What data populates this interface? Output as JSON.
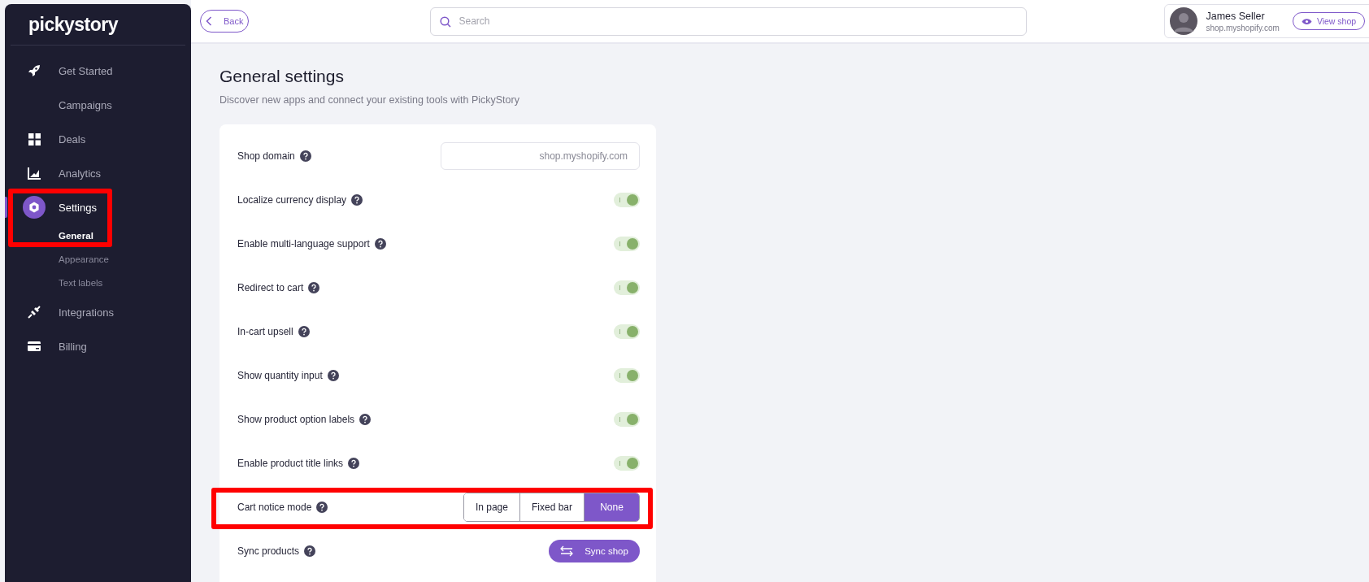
{
  "logo": {
    "text": "pickystory"
  },
  "sidebar": {
    "items": [
      {
        "label": "Get Started",
        "selected": false,
        "highlighted": false
      },
      {
        "label": "Campaigns",
        "selected": false,
        "highlighted": false
      },
      {
        "label": "Deals",
        "selected": false,
        "highlighted": false
      },
      {
        "label": "Analytics",
        "selected": false,
        "highlighted": false
      },
      {
        "label": "Settings",
        "selected": true,
        "highlighted": true,
        "children": [
          {
            "label": "General",
            "selected": true
          },
          {
            "label": "Appearance",
            "selected": false
          },
          {
            "label": "Text labels",
            "selected": false
          }
        ]
      },
      {
        "label": "Integrations",
        "selected": false,
        "highlighted": false
      },
      {
        "label": "Billing",
        "selected": false,
        "highlighted": false
      }
    ]
  },
  "topbar": {
    "back_button": "Back",
    "search": {
      "placeholder": "Search"
    },
    "user": {
      "name": "James Seller",
      "shop": "shop.myshopify.com"
    },
    "view_shop_button": "View shop"
  },
  "page": {
    "title": "General settings",
    "subtitle": "Discover new apps and connect your existing tools with PickyStory"
  },
  "settings": [
    {
      "kind": "text_field",
      "label": "Shop domain",
      "placeholder": "shop.myshopify.com",
      "highlighted": false
    },
    {
      "kind": "toggle",
      "label": "Localize currency display",
      "on": true,
      "highlighted": false
    },
    {
      "kind": "toggle",
      "label": "Enable multi-language support",
      "on": true,
      "highlighted": false
    },
    {
      "kind": "toggle",
      "label": "Redirect to cart",
      "on": true,
      "highlighted": false
    },
    {
      "kind": "toggle",
      "label": "In-cart upsell",
      "on": true,
      "highlighted": false
    },
    {
      "kind": "toggle",
      "label": "Show quantity input",
      "on": true,
      "highlighted": false
    },
    {
      "kind": "toggle",
      "label": "Show product option labels",
      "on": true,
      "highlighted": false
    },
    {
      "kind": "toggle",
      "label": "Enable product title links",
      "on": true,
      "highlighted": false
    },
    {
      "kind": "segmented",
      "label": "Cart notice mode",
      "highlighted": true,
      "options": [
        {
          "label": "In page",
          "selected": false
        },
        {
          "label": "Fixed bar",
          "selected": false
        },
        {
          "label": "None",
          "selected": true
        }
      ]
    },
    {
      "kind": "button",
      "label": "Sync products",
      "button": "Sync shop",
      "highlighted": false
    }
  ]
}
